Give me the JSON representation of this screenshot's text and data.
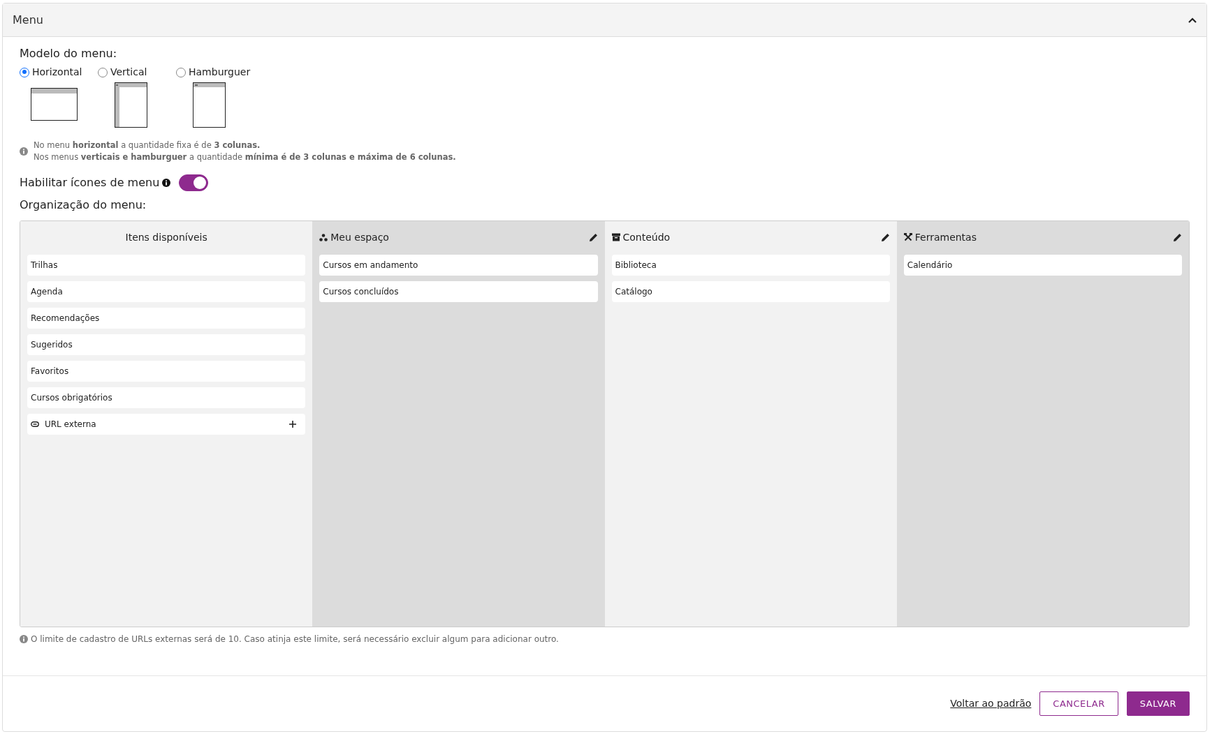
{
  "panel": {
    "title": "Menu",
    "expanded": true
  },
  "model": {
    "label": "Modelo do menu:",
    "options": [
      {
        "label": "Horizontal",
        "kind": "horizontal",
        "selected": true
      },
      {
        "label": "Vertical",
        "kind": "vertical",
        "selected": false
      },
      {
        "label": "Hamburguer",
        "kind": "hamburger",
        "selected": false
      }
    ],
    "notes": [
      "No menu **horizontal** a quantidade fixa é de **3 colunas.**",
      "Nos menus **verticais e hamburguer** a quantidade **mínima é de 3 colunas e máxima de 6 colunas.**"
    ]
  },
  "icons_toggle": {
    "label": "Habilitar ícones de menu",
    "on": true
  },
  "organization": {
    "label": "Organização do menu:",
    "available": {
      "title": "Itens disponíveis",
      "items": [
        {
          "label": "Trilhas",
          "kind": "item"
        },
        {
          "label": "Agenda",
          "kind": "item"
        },
        {
          "label": "Recomendações",
          "kind": "item"
        },
        {
          "label": "Sugeridos",
          "kind": "item"
        },
        {
          "label": "Favoritos",
          "kind": "item"
        },
        {
          "label": "Cursos obrigatórios",
          "kind": "item"
        },
        {
          "label": "URL externa",
          "kind": "link"
        }
      ]
    },
    "columns": [
      {
        "title": "Meu espaço",
        "items": [
          "Cursos em andamento",
          "Cursos concluídos"
        ]
      },
      {
        "title": "Conteúdo",
        "items": [
          "Biblioteca",
          "Catálogo"
        ]
      },
      {
        "title": "Ferramentas",
        "items": [
          "Calendário"
        ]
      }
    ],
    "footnote": "O limite de cadastro de URLs externas será de 10. Caso atinja este limite, será necessário excluir algum para adicionar outro."
  },
  "footer": {
    "reset_link": "Voltar ao padrão",
    "cancel": "CANCELAR",
    "save": "SALVAR"
  }
}
